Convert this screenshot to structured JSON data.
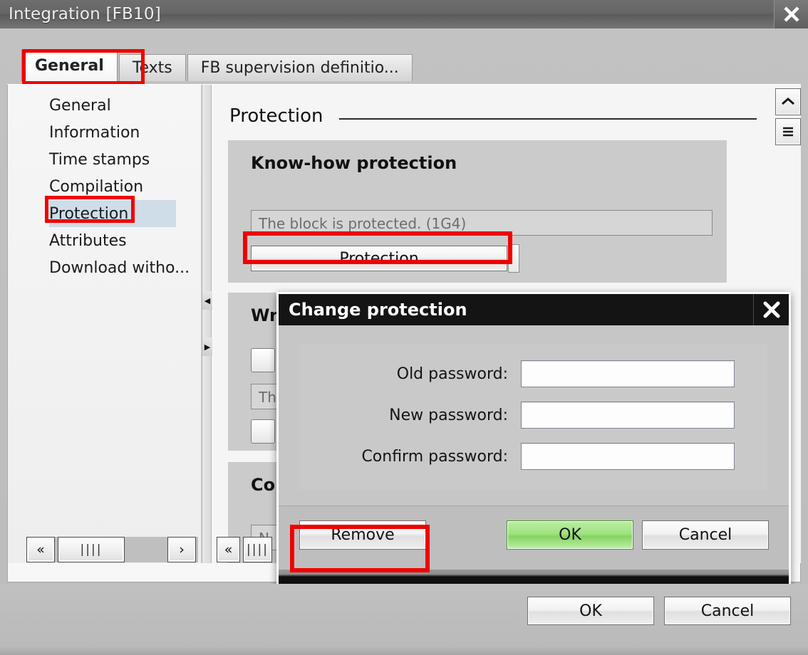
{
  "window": {
    "title": "Integration [FB10]",
    "close_icon": "close-icon"
  },
  "tabs": [
    {
      "label": "General",
      "active": true
    },
    {
      "label": "Texts",
      "active": false
    },
    {
      "label": "FB supervision definitio...",
      "active": false
    }
  ],
  "sidebar": {
    "items": [
      {
        "label": "General",
        "selected": false
      },
      {
        "label": "Information",
        "selected": false
      },
      {
        "label": "Time stamps",
        "selected": false
      },
      {
        "label": "Compilation",
        "selected": false
      },
      {
        "label": "Protection",
        "selected": true
      },
      {
        "label": "Attributes",
        "selected": false
      },
      {
        "label": "Download witho...",
        "selected": false
      }
    ],
    "scroll": {
      "left_label": "«",
      "right_label": "»",
      "thumb_label": "||||"
    }
  },
  "content": {
    "heading": "Protection",
    "knowhow": {
      "title": "Know-how protection",
      "status_text": "The block is protected. (1G4)",
      "button_label": "Protection"
    },
    "write": {
      "title_visible": "Wri",
      "status_visible": "Th"
    },
    "copy": {
      "title_visible": "Co",
      "status_visible": "N"
    },
    "scroll": {
      "up_icon": "chevron-up-icon",
      "menu_icon": "hamburger-menu-icon",
      "left_label": "«",
      "thumb_label": "||||"
    }
  },
  "change_dialog": {
    "title": "Change protection",
    "close_icon": "close-icon",
    "fields": [
      {
        "label": "Old password:",
        "value": "",
        "placeholder": ""
      },
      {
        "label": "New password:",
        "value": "",
        "placeholder": ""
      },
      {
        "label": "Confirm password:",
        "value": "",
        "placeholder": ""
      }
    ],
    "buttons": {
      "remove": "Remove",
      "ok": "OK",
      "cancel": "Cancel"
    }
  },
  "footer": {
    "ok": "OK",
    "cancel": "Cancel"
  },
  "colors": {
    "highlight_red": "#f00000",
    "ok_green": "#9fe383",
    "selection_blue": "#cfdde9",
    "titlebar_gray": "#666666",
    "dialog_titlebar": "#141414"
  }
}
